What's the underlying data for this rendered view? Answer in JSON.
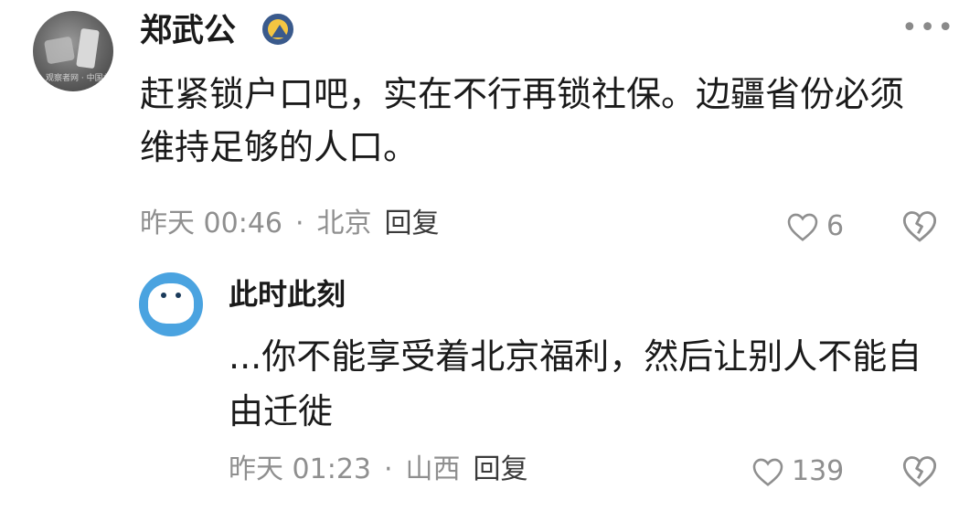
{
  "comment": {
    "user": "郑武公",
    "avatar_caption": "观察者网 · 中国北京",
    "more_label": "•••",
    "text": "赶紧锁户口吧，实在不行再锁社保。边疆省份必须维持足够的人口。",
    "time": "昨天 00:46",
    "separator": "·",
    "location": "北京",
    "reply_label": "回复",
    "likes": "6"
  },
  "reply": {
    "user": "此时此刻",
    "text": "...你不能享受着北京福利，然后让别人不能自由迁徙",
    "time": "昨天 01:23",
    "separator": "·",
    "location": "山西",
    "reply_label": "回复",
    "likes": "139"
  },
  "icons": {
    "like": "heart-outline-icon",
    "dislike": "broken-heart-icon",
    "more": "more-horizontal-icon",
    "badge": "verified-badge-icon"
  },
  "colors": {
    "text": "#1a1a1a",
    "meta": "#8f8f8f",
    "badge_blue": "#3a5a8c",
    "badge_yellow": "#f4c542",
    "avatar_blue": "#4aa3e0"
  }
}
